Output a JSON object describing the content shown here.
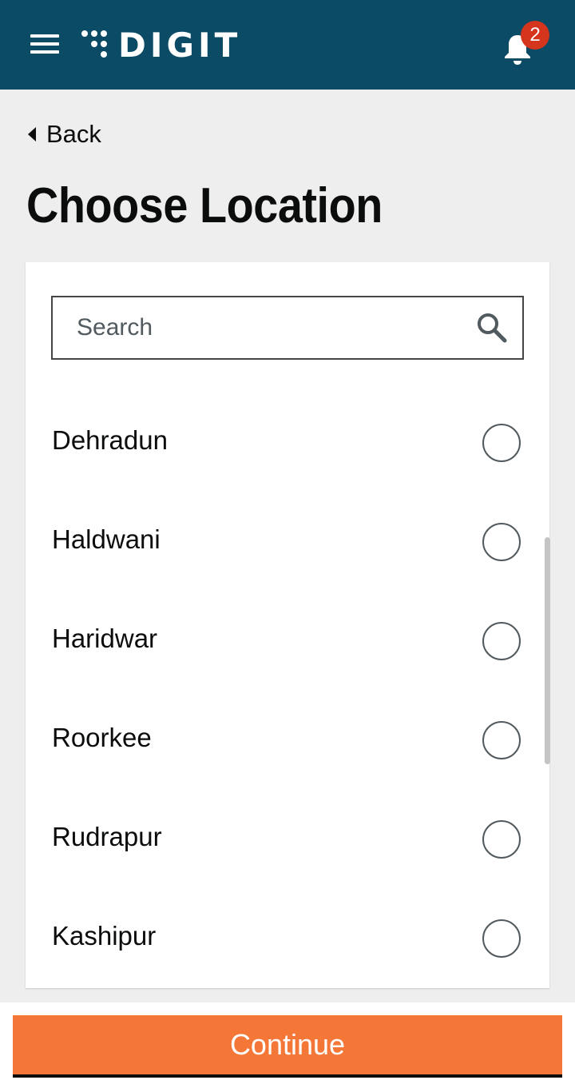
{
  "header": {
    "logo_text": "DIGIT",
    "notification_count": "2",
    "bg_color": "#0b4b66"
  },
  "back_label": "Back",
  "page_title": "Choose Location",
  "search": {
    "placeholder": "Search",
    "value": ""
  },
  "locations": [
    {
      "label": "Dehradun",
      "selected": false
    },
    {
      "label": "Haldwani",
      "selected": false
    },
    {
      "label": "Haridwar",
      "selected": false
    },
    {
      "label": "Roorkee",
      "selected": false
    },
    {
      "label": "Rudrapur",
      "selected": false
    },
    {
      "label": "Kashipur",
      "selected": false
    }
  ],
  "continue_label": "Continue",
  "colors": {
    "primary_button": "#f47738",
    "badge": "#d4351c"
  },
  "icons": [
    "menu-icon",
    "digit-logo-icon",
    "bell-icon",
    "chevron-left-icon",
    "search-icon",
    "radio-unchecked-icon"
  ]
}
